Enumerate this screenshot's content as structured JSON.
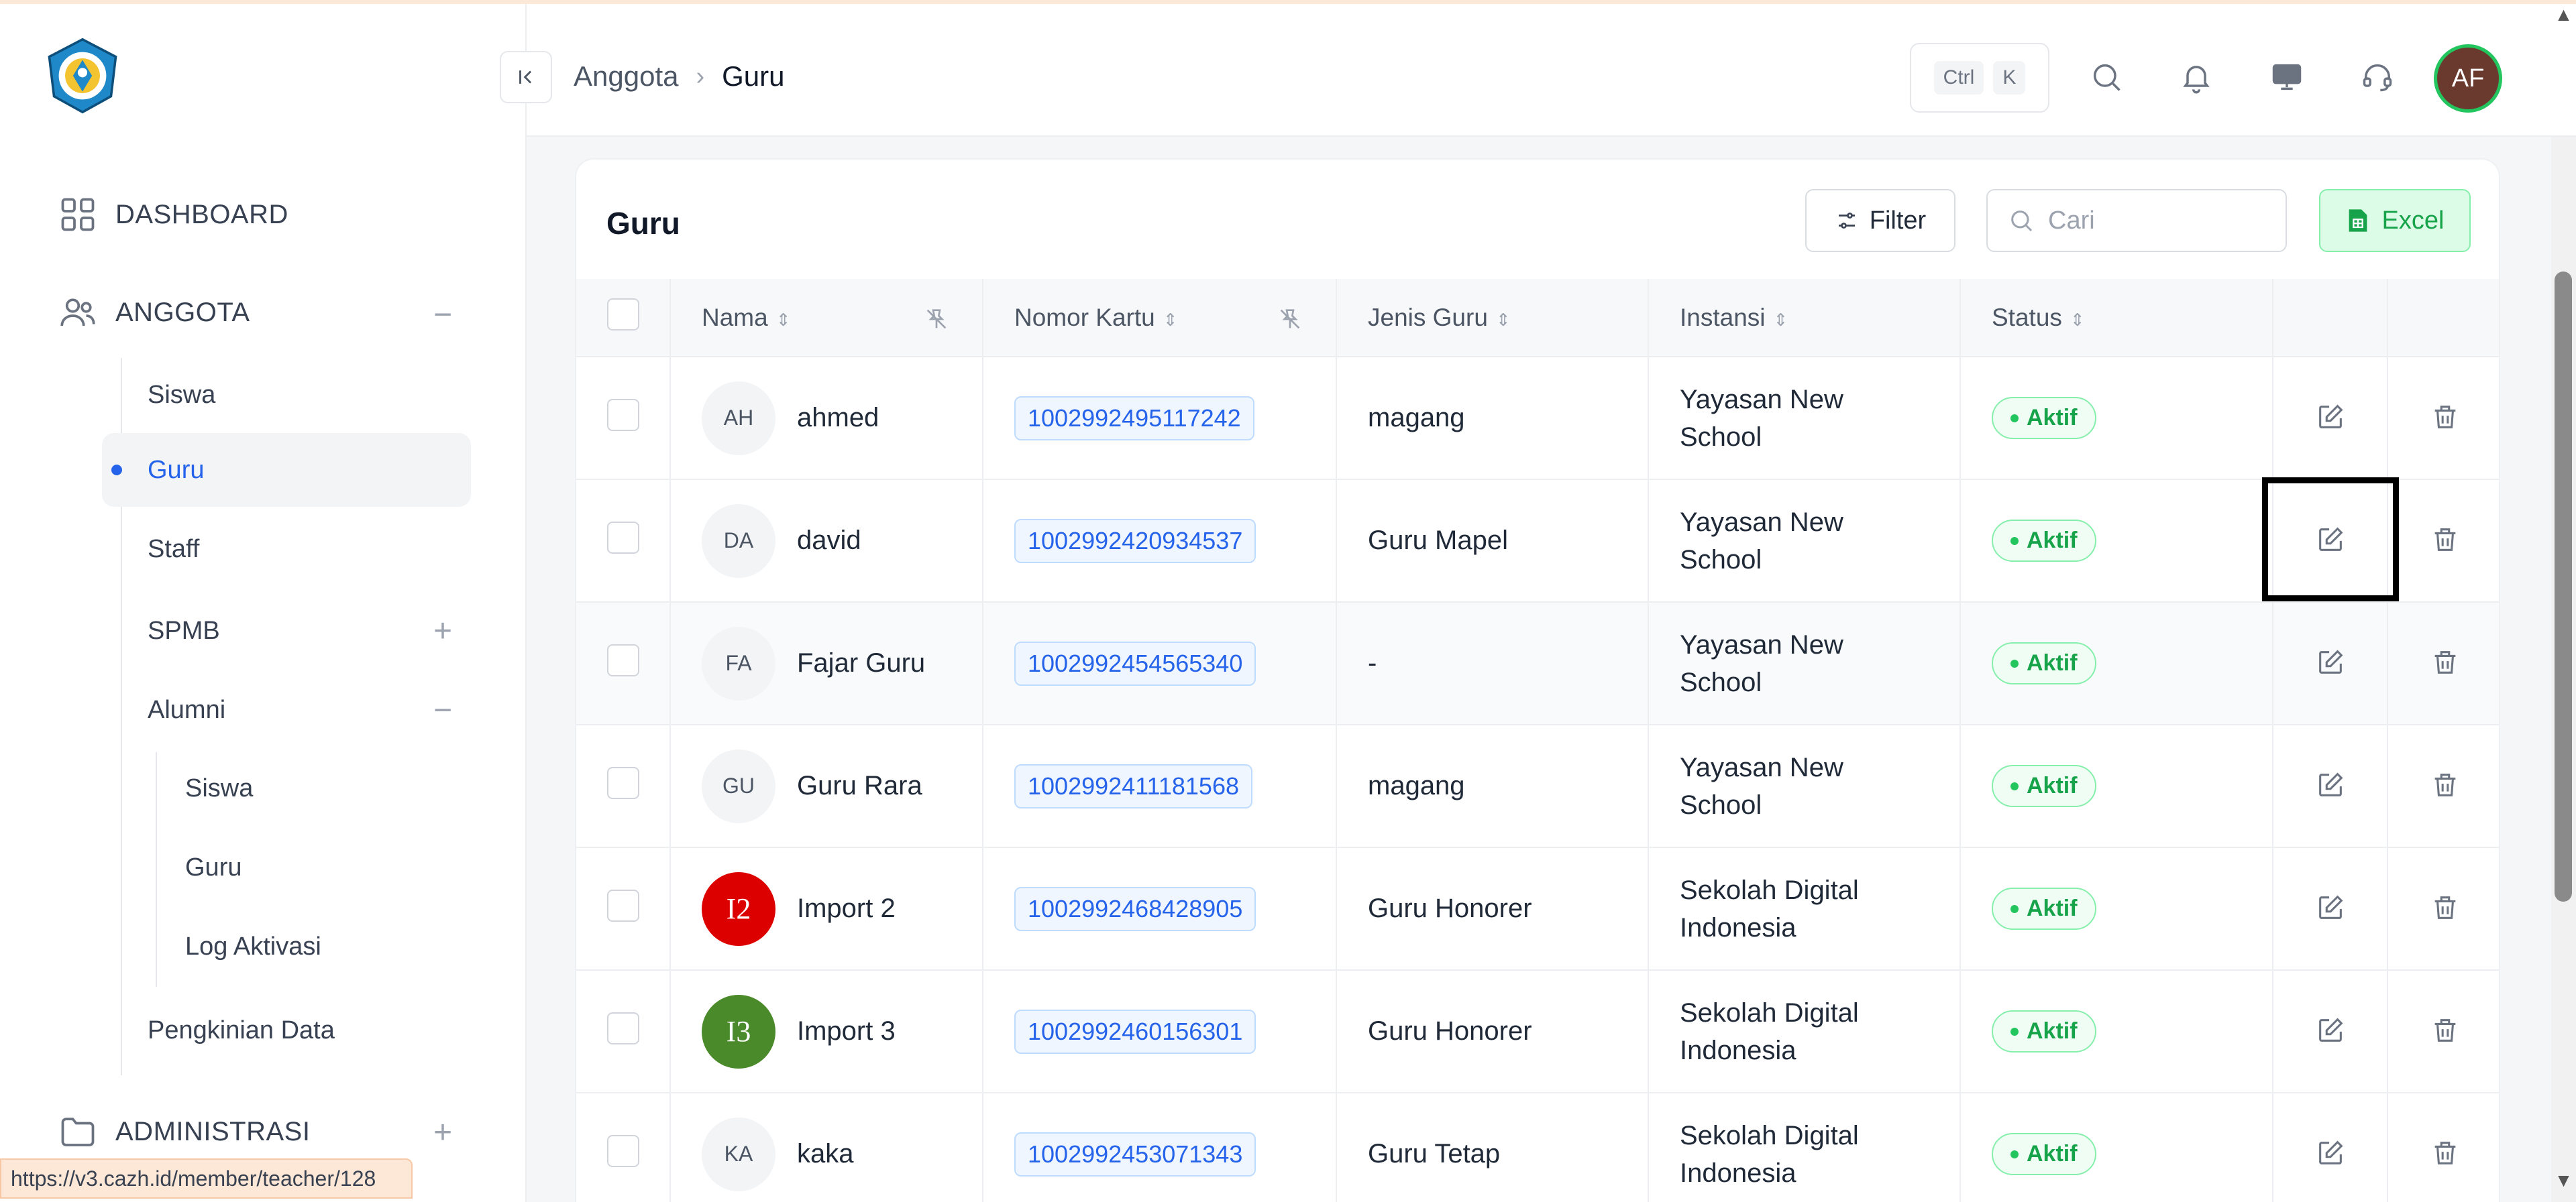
{
  "sidebar": {
    "logo_icon": "tut-wuri-handayani-logo",
    "sections": [
      {
        "label": "DASHBOARD",
        "icon": "dashboard-grid-icon"
      },
      {
        "label": "ANGGOTA",
        "icon": "users-icon",
        "toggle": "−"
      },
      {
        "label": "ADMINISTRASI",
        "icon": "folder-icon",
        "toggle": "+"
      }
    ],
    "anggota_items": [
      "Siswa",
      "Guru",
      "Staff",
      "SPMB",
      "Alumni",
      "Pengkinian Data"
    ],
    "spmb_toggle": "+",
    "alumni_toggle": "−",
    "alumni_items": [
      "Siswa",
      "Guru",
      "Log Aktivasi"
    ]
  },
  "status_url": "https://v3.cazh.id/member/teacher/128",
  "header": {
    "breadcrumb": [
      "Anggota",
      "Guru"
    ],
    "shortcut": [
      "Ctrl",
      "K"
    ],
    "icons": [
      "search-icon",
      "bell-icon",
      "monitor-icon",
      "headset-icon"
    ],
    "user_initials": "AF"
  },
  "card": {
    "title": "Guru",
    "filter_label": "Filter",
    "search_placeholder": "Cari",
    "excel_label": "Excel"
  },
  "table": {
    "columns": [
      "Nama",
      "Nomor Kartu",
      "Jenis Guru",
      "Instansi",
      "Status"
    ],
    "rows": [
      {
        "initials": "AH",
        "name": "ahmed",
        "card": "1002992495117242",
        "type": "magang",
        "inst1": "Yayasan New",
        "inst2": "School",
        "status": "Aktif"
      },
      {
        "initials": "DA",
        "name": "david",
        "card": "1002992420934537",
        "type": "Guru Mapel",
        "inst1": "Yayasan New",
        "inst2": "School",
        "status": "Aktif"
      },
      {
        "initials": "FA",
        "name": "Fajar Guru",
        "card": "1002992454565340",
        "type": "-",
        "inst1": "Yayasan New",
        "inst2": "School",
        "status": "Aktif"
      },
      {
        "initials": "GU",
        "name": "Guru Rara",
        "card": "1002992411181568",
        "type": "magang",
        "inst1": "Yayasan New",
        "inst2": "School",
        "status": "Aktif"
      },
      {
        "initials": "I2",
        "name": "Import 2",
        "card": "1002992468428905",
        "type": "Guru Honorer",
        "inst1": "Sekolah Digital",
        "inst2": "Indonesia",
        "status": "Aktif",
        "avatar_color": "#dc0000"
      },
      {
        "initials": "I3",
        "name": "Import 3",
        "card": "1002992460156301",
        "type": "Guru Honorer",
        "inst1": "Sekolah Digital",
        "inst2": "Indonesia",
        "status": "Aktif",
        "avatar_color": "#4a8a2a"
      },
      {
        "initials": "KA",
        "name": "kaka",
        "card": "1002992453071343",
        "type": "Guru Tetap",
        "inst1": "Sekolah Digital",
        "inst2": "Indonesia",
        "status": "Aktif"
      }
    ]
  },
  "colors": {
    "accent": "#2563eb",
    "success": "#16a34a"
  }
}
